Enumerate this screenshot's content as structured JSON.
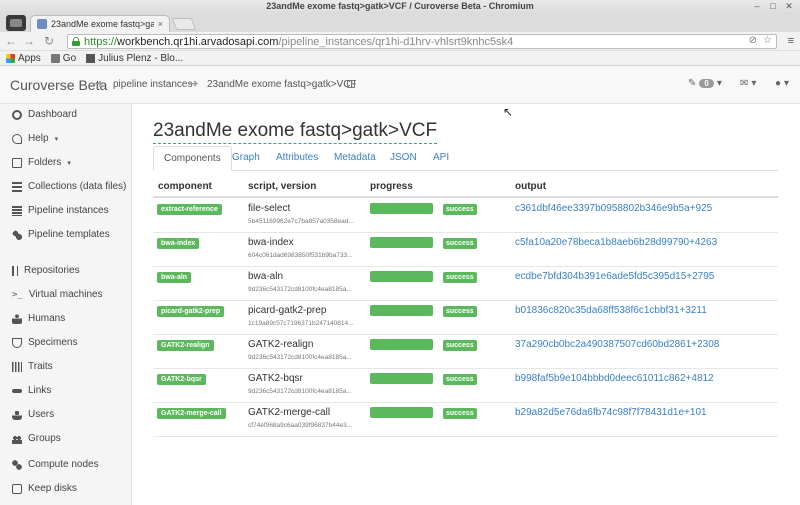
{
  "window": {
    "title": "23andMe exome fastq>gatk>VCF / Curoverse Beta - Chromium"
  },
  "browser": {
    "tab_title": "23andMe exome fastq>gat",
    "tab_close": "×",
    "url_scheme": "https://",
    "url_host": "workbench.qr1hi.arvadosapi.com",
    "url_path": "/pipeline_instances/qr1hi-d1hrv-vhlsrt9knhc5sk4"
  },
  "bookmarks": [
    {
      "label": "Apps",
      "icon": "apps-icon"
    },
    {
      "label": "Go",
      "icon": "folder-icon"
    },
    {
      "label": "Julius Plenz - Blo...",
      "icon": "bookmark-icon"
    }
  ],
  "navbar": {
    "brand": "Curoverse Beta",
    "breadcrumbs": [
      "pipeline instances",
      "23andMe exome fastq>gatk>VCF"
    ],
    "notification_count": "0"
  },
  "sidebar": {
    "items": [
      {
        "label": "Dashboard",
        "icon": "dashboard-icon"
      },
      {
        "label": "Help",
        "icon": "help-icon",
        "caret": true
      },
      {
        "label": "Folders",
        "icon": "folder-icon",
        "caret": true
      },
      {
        "label": "Collections (data files)",
        "icon": "collections-icon"
      },
      {
        "label": "Pipeline instances",
        "icon": "pipeline-instances-icon"
      },
      {
        "label": "Pipeline templates",
        "icon": "pipeline-templates-icon"
      },
      {
        "label": "Repositories",
        "icon": "repository-icon"
      },
      {
        "label": "Virtual machines",
        "icon": "terminal-icon"
      },
      {
        "label": "Humans",
        "icon": "human-icon"
      },
      {
        "label": "Specimens",
        "icon": "specimen-icon"
      },
      {
        "label": "Traits",
        "icon": "traits-icon"
      },
      {
        "label": "Links",
        "icon": "links-icon"
      },
      {
        "label": "Users",
        "icon": "user-icon"
      },
      {
        "label": "Groups",
        "icon": "groups-icon"
      },
      {
        "label": "Compute nodes",
        "icon": "compute-nodes-icon"
      },
      {
        "label": "Keep disks",
        "icon": "keep-disks-icon"
      }
    ]
  },
  "main": {
    "title": "23andMe exome fastq>gatk>VCF",
    "tabs": [
      {
        "label": "Components",
        "active": true
      },
      {
        "label": "Graph"
      },
      {
        "label": "Attributes"
      },
      {
        "label": "Metadata"
      },
      {
        "label": "JSON"
      },
      {
        "label": "API"
      }
    ],
    "table": {
      "headers": [
        "component",
        "script, version",
        "progress",
        "output"
      ],
      "rows": [
        {
          "component": "extract-reference",
          "script": "file-select",
          "version": "5b451169962e7c7ba857a0358ead...",
          "progress": 1.0,
          "status": "success",
          "output": "c361dbf46ee3397b0958802b346e9b5a+925"
        },
        {
          "component": "bwa-index",
          "script": "bwa-index",
          "version": "604c061dad6983850f531b9ba733...",
          "progress": 1.0,
          "status": "success",
          "output": "c5fa10a20e78beca1b8aeb6b28d99790+4263"
        },
        {
          "component": "bwa-aln",
          "script": "bwa-aln",
          "version": "9d236c543172cd8100fc4ea8185a...",
          "progress": 1.0,
          "status": "success",
          "output": "ecdbe7bfd304b391e6ade5fd5c395d15+2795"
        },
        {
          "component": "picard-gatk2-prep",
          "script": "picard-gatk2-prep",
          "version": "1c19a89c57c7196371b247140814...",
          "progress": 1.0,
          "status": "success",
          "output": "b01836c820c35da68ff538f6c1cbbf31+3211"
        },
        {
          "component": "GATK2-realign",
          "script": "GATK2-realign",
          "version": "9d236c543172cd8100fc4ea8185a...",
          "progress": 1.0,
          "status": "success",
          "output": "37a290cb0bc2a490387507cd60bd2861+2308"
        },
        {
          "component": "GATK2-bqsr",
          "script": "GATK2-bqsr",
          "version": "9d236c543172cd8100fc4ea8185a...",
          "progress": 1.0,
          "status": "success",
          "output": "b998faf5b9e104bbbd0deec61011c862+4812"
        },
        {
          "component": "GATK2-merge-call",
          "script": "GATK2-merge-call",
          "version": "cf74ef968a9c6aa039f96837b44e3...",
          "progress": 1.0,
          "status": "success",
          "output": "b29a82d5e76da6fb74c98f7f78431d1e+101"
        }
      ]
    }
  },
  "colors": {
    "success": "#5cb85c",
    "link": "#3a81c4"
  }
}
